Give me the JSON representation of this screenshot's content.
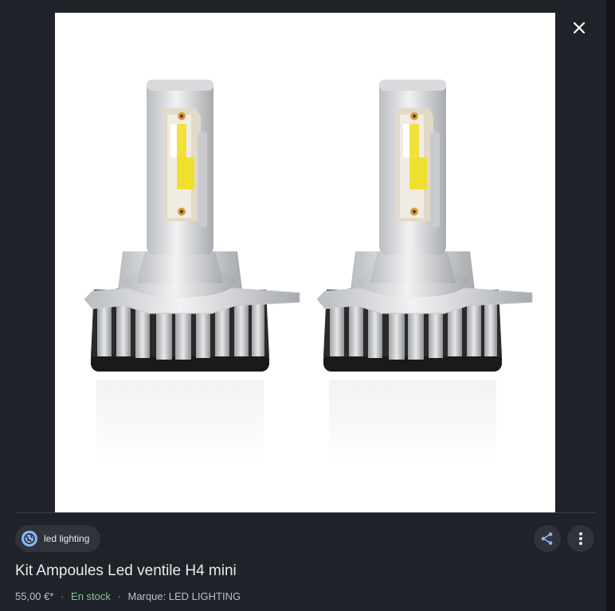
{
  "product": {
    "title": "Kit Ampoules Led ventile H4 mini",
    "price": "55,00 €*",
    "stock": "En stock",
    "brand": "Marque: LED LIGHTING",
    "separator": "·"
  },
  "source": {
    "label": "led lighting"
  },
  "icons": {
    "close": "close-icon",
    "globe": "globe-icon",
    "share": "share-icon",
    "more": "more-vert-icon"
  },
  "colors": {
    "background": "#1f2228",
    "chip": "#303339",
    "stock": "#81c995",
    "globe": "#8ab4f8"
  }
}
